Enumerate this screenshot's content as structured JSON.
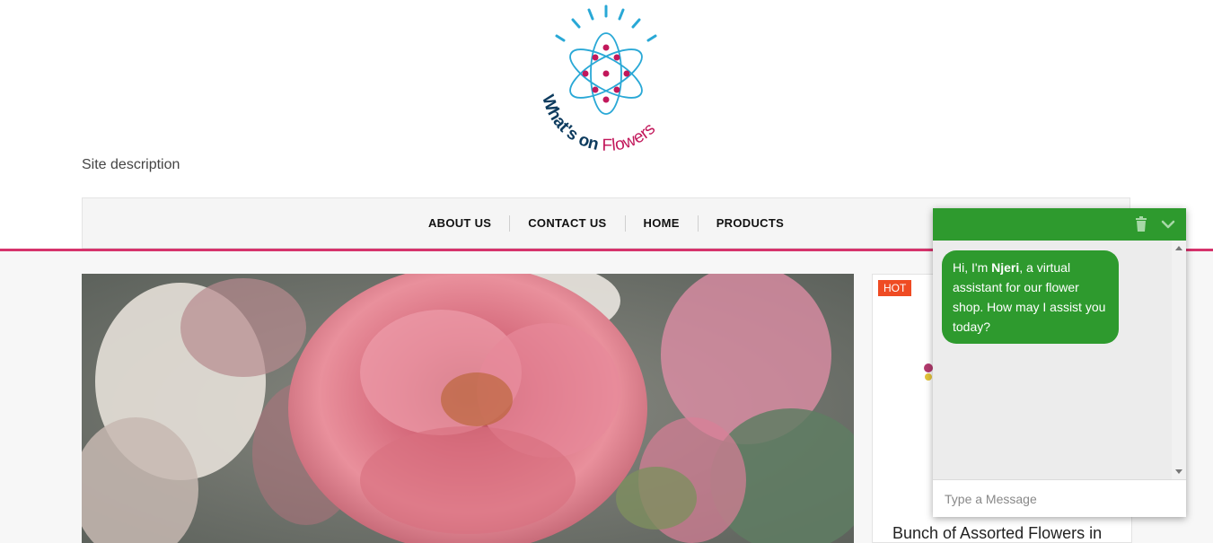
{
  "site": {
    "logo_text_part1": "What's on",
    "logo_text_part2": "Flowers",
    "description": "Site description"
  },
  "nav": {
    "items": [
      {
        "label": "ABOUT US"
      },
      {
        "label": "CONTACT US"
      },
      {
        "label": "HOME"
      },
      {
        "label": "PRODUCTS"
      }
    ]
  },
  "product": {
    "badge": "HOT",
    "title": "Bunch of Assorted Flowers in"
  },
  "chat": {
    "greeting_prefix": "Hi, I'm ",
    "assistant_name": "Njeri",
    "greeting_suffix": ", a virtual assistant for our flower shop. How may I assist you today?",
    "input_placeholder": "Type a Message"
  },
  "colors": {
    "accent_pink": "#d6336c",
    "chat_green": "#2e9a2e",
    "hot_badge": "#ef4b23",
    "logo_blue": "#29a8d6",
    "logo_magenta": "#c2185b",
    "logo_navy": "#0d3b5e"
  },
  "icons": {
    "trash": "trash-icon",
    "collapse": "chevron-down-icon"
  }
}
